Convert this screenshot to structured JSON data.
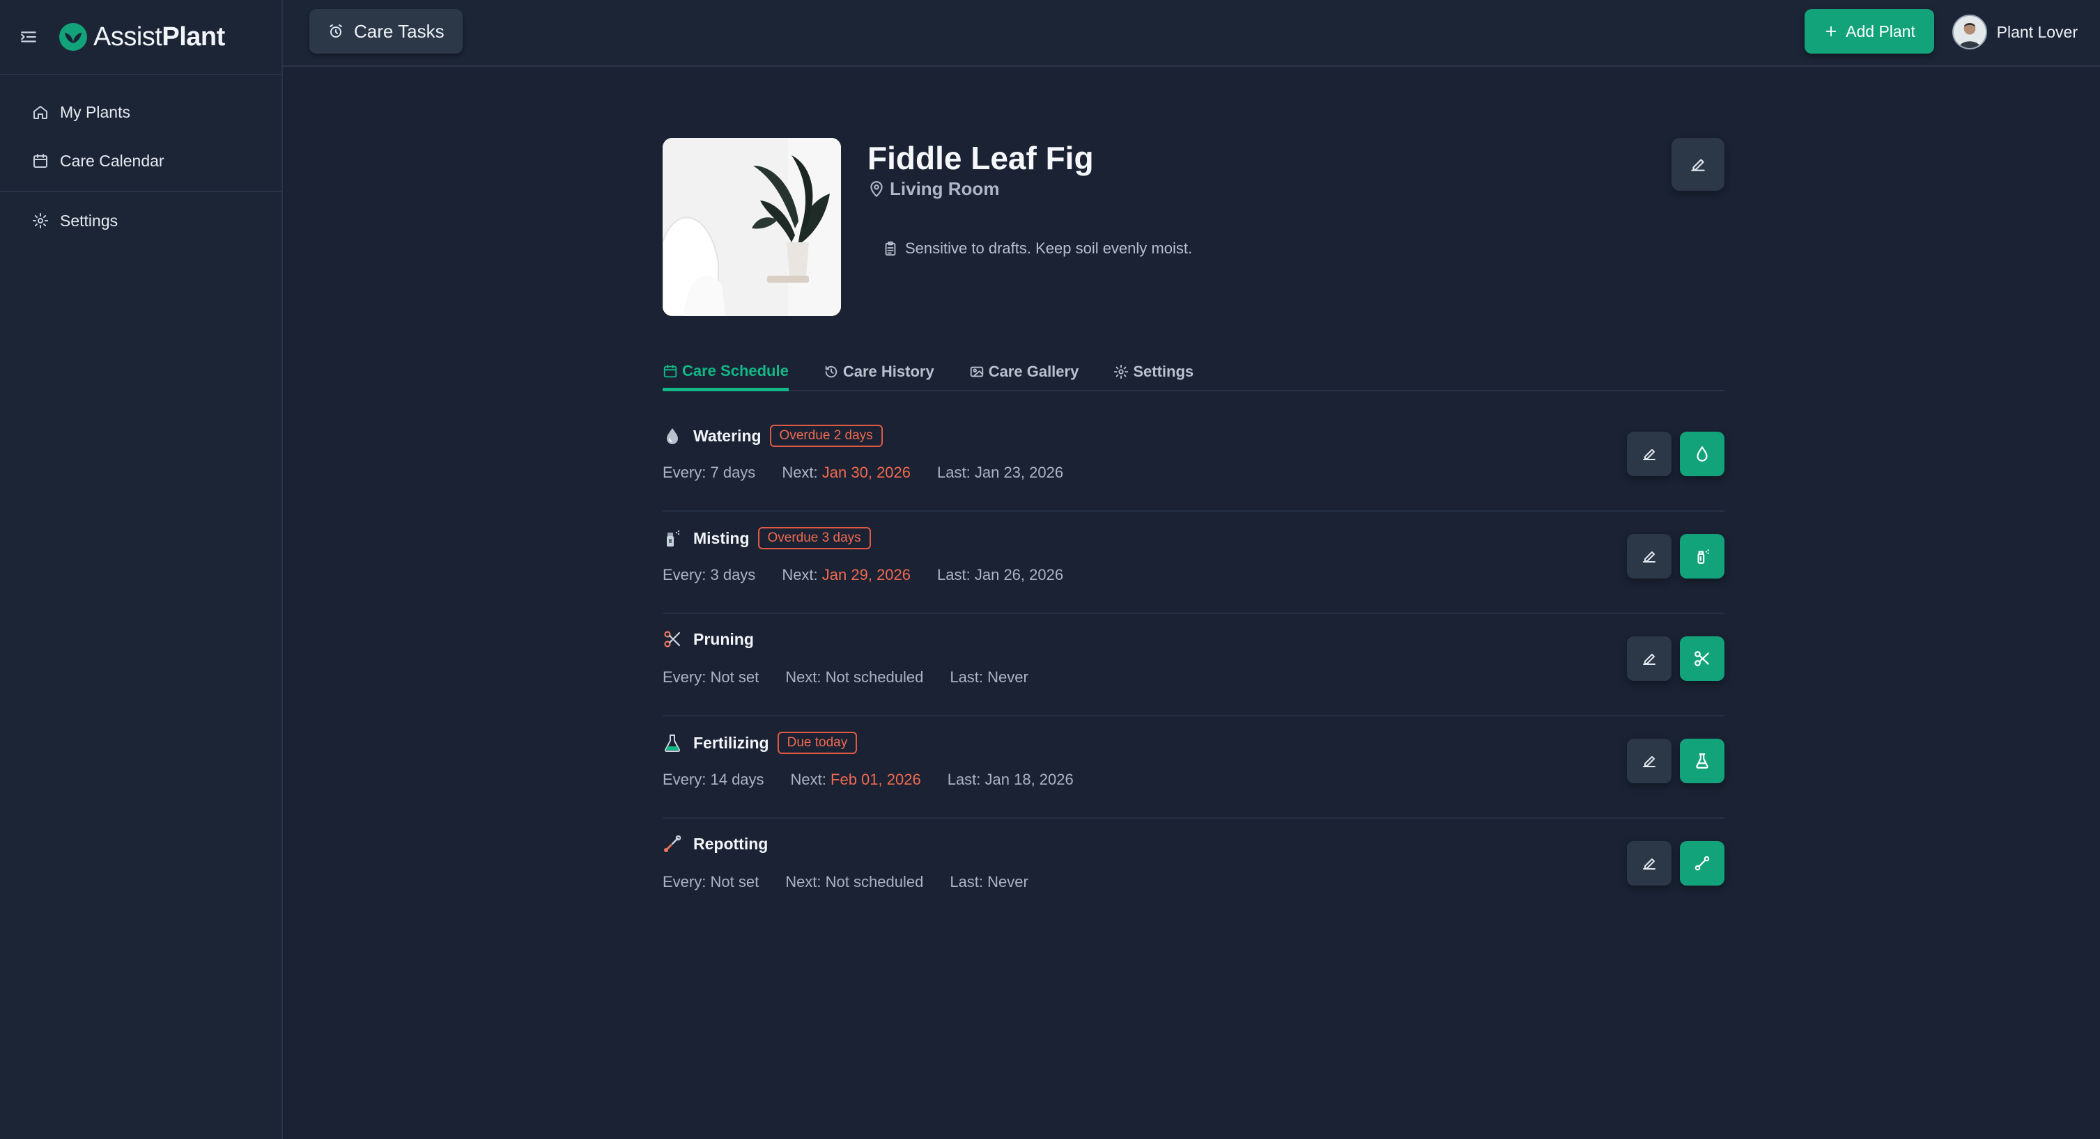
{
  "app": {
    "brand_prefix": "Assist",
    "brand_suffix": "Plant"
  },
  "sidebar": {
    "items": [
      {
        "label": "My Plants",
        "icon": "home-icon"
      },
      {
        "label": "Care Calendar",
        "icon": "calendar-icon"
      },
      {
        "label": "Settings",
        "icon": "gear-icon"
      }
    ]
  },
  "header": {
    "care_tasks_label": "Care Tasks",
    "add_plant_label": "Add Plant",
    "user_name": "Plant Lover"
  },
  "plant": {
    "name": "Fiddle Leaf Fig",
    "location": "Living Room",
    "note": "Sensitive to drafts. Keep soil evenly moist."
  },
  "tabs": [
    {
      "label": "Care Schedule",
      "icon": "calendar-icon",
      "active": true
    },
    {
      "label": "Care History",
      "icon": "history-icon",
      "active": false
    },
    {
      "label": "Care Gallery",
      "icon": "image-icon",
      "active": false
    },
    {
      "label": "Settings",
      "icon": "gear-icon",
      "active": false
    }
  ],
  "tasks": [
    {
      "name": "Watering",
      "icon": "water-drop-icon",
      "badge": "Overdue 2 days",
      "every_label": "Every:",
      "every": "7 days",
      "next_label": "Next:",
      "next": "Jan 30, 2026",
      "next_highlight": true,
      "last_label": "Last:",
      "last": "Jan 23, 2026"
    },
    {
      "name": "Misting",
      "icon": "spray-bottle-icon",
      "badge": "Overdue 3 days",
      "every_label": "Every:",
      "every": "3 days",
      "next_label": "Next:",
      "next": "Jan 29, 2026",
      "next_highlight": true,
      "last_label": "Last:",
      "last": "Jan 26, 2026"
    },
    {
      "name": "Pruning",
      "icon": "scissors-icon",
      "badge": "",
      "every_label": "Every:",
      "every": "Not set",
      "next_label": "Next:",
      "next": "Not scheduled",
      "next_highlight": false,
      "last_label": "Last:",
      "last": "Never"
    },
    {
      "name": "Fertilizing",
      "icon": "flask-icon",
      "badge": "Due today",
      "every_label": "Every:",
      "every": "14 days",
      "next_label": "Next:",
      "next": "Feb 01, 2026",
      "next_highlight": true,
      "last_label": "Last:",
      "last": "Jan 18, 2026"
    },
    {
      "name": "Repotting",
      "icon": "trowel-icon",
      "badge": "",
      "every_label": "Every:",
      "every": "Not set",
      "next_label": "Next:",
      "next": "Not scheduled",
      "next_highlight": false,
      "last_label": "Last:",
      "last": "Never"
    }
  ],
  "colors": {
    "accent": "#12a37a",
    "overdue": "#f06a50",
    "background": "#1a2233"
  }
}
